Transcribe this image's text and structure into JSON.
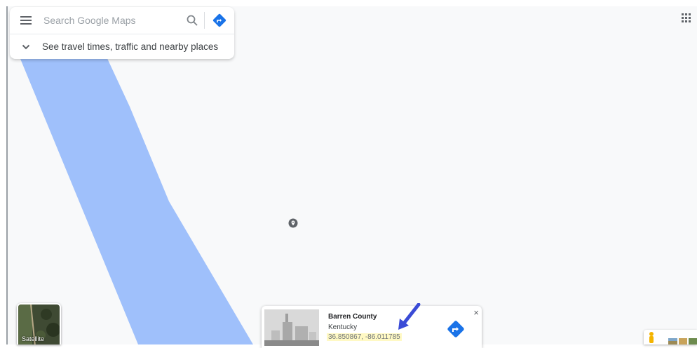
{
  "search": {
    "placeholder": "Search Google Maps",
    "travel_hint": "See travel times, traffic and nearby places"
  },
  "layers": {
    "satellite_label": "Satellite"
  },
  "place_card": {
    "name": "Barren County",
    "region": "Kentucky",
    "coordinates": "36.850867, -86.011785",
    "close_label": "×"
  },
  "colors": {
    "river": "#9fc0fb",
    "accent": "#1a73e8",
    "map_background": "#f8f9fa",
    "annotation_arrow": "#3a4bd6",
    "coords_highlight": "#fff9c4"
  },
  "icons": {
    "menu": "hamburger-menu-icon",
    "search": "magnifier-icon",
    "directions": "directions-diamond-icon",
    "expand": "chevron-down-icon",
    "apps": "apps-grid-icon",
    "pin": "location-pin-icon",
    "pegman": "pegman-icon"
  }
}
